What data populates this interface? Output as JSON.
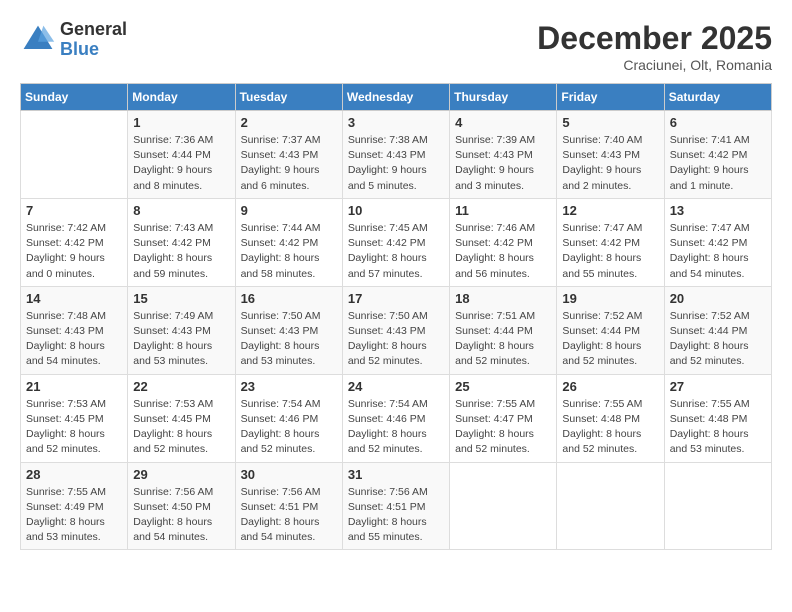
{
  "logo": {
    "general": "General",
    "blue": "Blue"
  },
  "header": {
    "month": "December 2025",
    "location": "Craciunei, Olt, Romania"
  },
  "weekdays": [
    "Sunday",
    "Monday",
    "Tuesday",
    "Wednesday",
    "Thursday",
    "Friday",
    "Saturday"
  ],
  "weeks": [
    [
      {
        "day": "",
        "sunrise": "",
        "sunset": "",
        "daylight": ""
      },
      {
        "day": "1",
        "sunrise": "Sunrise: 7:36 AM",
        "sunset": "Sunset: 4:44 PM",
        "daylight": "Daylight: 9 hours and 8 minutes."
      },
      {
        "day": "2",
        "sunrise": "Sunrise: 7:37 AM",
        "sunset": "Sunset: 4:43 PM",
        "daylight": "Daylight: 9 hours and 6 minutes."
      },
      {
        "day": "3",
        "sunrise": "Sunrise: 7:38 AM",
        "sunset": "Sunset: 4:43 PM",
        "daylight": "Daylight: 9 hours and 5 minutes."
      },
      {
        "day": "4",
        "sunrise": "Sunrise: 7:39 AM",
        "sunset": "Sunset: 4:43 PM",
        "daylight": "Daylight: 9 hours and 3 minutes."
      },
      {
        "day": "5",
        "sunrise": "Sunrise: 7:40 AM",
        "sunset": "Sunset: 4:43 PM",
        "daylight": "Daylight: 9 hours and 2 minutes."
      },
      {
        "day": "6",
        "sunrise": "Sunrise: 7:41 AM",
        "sunset": "Sunset: 4:42 PM",
        "daylight": "Daylight: 9 hours and 1 minute."
      }
    ],
    [
      {
        "day": "7",
        "sunrise": "Sunrise: 7:42 AM",
        "sunset": "Sunset: 4:42 PM",
        "daylight": "Daylight: 9 hours and 0 minutes."
      },
      {
        "day": "8",
        "sunrise": "Sunrise: 7:43 AM",
        "sunset": "Sunset: 4:42 PM",
        "daylight": "Daylight: 8 hours and 59 minutes."
      },
      {
        "day": "9",
        "sunrise": "Sunrise: 7:44 AM",
        "sunset": "Sunset: 4:42 PM",
        "daylight": "Daylight: 8 hours and 58 minutes."
      },
      {
        "day": "10",
        "sunrise": "Sunrise: 7:45 AM",
        "sunset": "Sunset: 4:42 PM",
        "daylight": "Daylight: 8 hours and 57 minutes."
      },
      {
        "day": "11",
        "sunrise": "Sunrise: 7:46 AM",
        "sunset": "Sunset: 4:42 PM",
        "daylight": "Daylight: 8 hours and 56 minutes."
      },
      {
        "day": "12",
        "sunrise": "Sunrise: 7:47 AM",
        "sunset": "Sunset: 4:42 PM",
        "daylight": "Daylight: 8 hours and 55 minutes."
      },
      {
        "day": "13",
        "sunrise": "Sunrise: 7:47 AM",
        "sunset": "Sunset: 4:42 PM",
        "daylight": "Daylight: 8 hours and 54 minutes."
      }
    ],
    [
      {
        "day": "14",
        "sunrise": "Sunrise: 7:48 AM",
        "sunset": "Sunset: 4:43 PM",
        "daylight": "Daylight: 8 hours and 54 minutes."
      },
      {
        "day": "15",
        "sunrise": "Sunrise: 7:49 AM",
        "sunset": "Sunset: 4:43 PM",
        "daylight": "Daylight: 8 hours and 53 minutes."
      },
      {
        "day": "16",
        "sunrise": "Sunrise: 7:50 AM",
        "sunset": "Sunset: 4:43 PM",
        "daylight": "Daylight: 8 hours and 53 minutes."
      },
      {
        "day": "17",
        "sunrise": "Sunrise: 7:50 AM",
        "sunset": "Sunset: 4:43 PM",
        "daylight": "Daylight: 8 hours and 52 minutes."
      },
      {
        "day": "18",
        "sunrise": "Sunrise: 7:51 AM",
        "sunset": "Sunset: 4:44 PM",
        "daylight": "Daylight: 8 hours and 52 minutes."
      },
      {
        "day": "19",
        "sunrise": "Sunrise: 7:52 AM",
        "sunset": "Sunset: 4:44 PM",
        "daylight": "Daylight: 8 hours and 52 minutes."
      },
      {
        "day": "20",
        "sunrise": "Sunrise: 7:52 AM",
        "sunset": "Sunset: 4:44 PM",
        "daylight": "Daylight: 8 hours and 52 minutes."
      }
    ],
    [
      {
        "day": "21",
        "sunrise": "Sunrise: 7:53 AM",
        "sunset": "Sunset: 4:45 PM",
        "daylight": "Daylight: 8 hours and 52 minutes."
      },
      {
        "day": "22",
        "sunrise": "Sunrise: 7:53 AM",
        "sunset": "Sunset: 4:45 PM",
        "daylight": "Daylight: 8 hours and 52 minutes."
      },
      {
        "day": "23",
        "sunrise": "Sunrise: 7:54 AM",
        "sunset": "Sunset: 4:46 PM",
        "daylight": "Daylight: 8 hours and 52 minutes."
      },
      {
        "day": "24",
        "sunrise": "Sunrise: 7:54 AM",
        "sunset": "Sunset: 4:46 PM",
        "daylight": "Daylight: 8 hours and 52 minutes."
      },
      {
        "day": "25",
        "sunrise": "Sunrise: 7:55 AM",
        "sunset": "Sunset: 4:47 PM",
        "daylight": "Daylight: 8 hours and 52 minutes."
      },
      {
        "day": "26",
        "sunrise": "Sunrise: 7:55 AM",
        "sunset": "Sunset: 4:48 PM",
        "daylight": "Daylight: 8 hours and 52 minutes."
      },
      {
        "day": "27",
        "sunrise": "Sunrise: 7:55 AM",
        "sunset": "Sunset: 4:48 PM",
        "daylight": "Daylight: 8 hours and 53 minutes."
      }
    ],
    [
      {
        "day": "28",
        "sunrise": "Sunrise: 7:55 AM",
        "sunset": "Sunset: 4:49 PM",
        "daylight": "Daylight: 8 hours and 53 minutes."
      },
      {
        "day": "29",
        "sunrise": "Sunrise: 7:56 AM",
        "sunset": "Sunset: 4:50 PM",
        "daylight": "Daylight: 8 hours and 54 minutes."
      },
      {
        "day": "30",
        "sunrise": "Sunrise: 7:56 AM",
        "sunset": "Sunset: 4:51 PM",
        "daylight": "Daylight: 8 hours and 54 minutes."
      },
      {
        "day": "31",
        "sunrise": "Sunrise: 7:56 AM",
        "sunset": "Sunset: 4:51 PM",
        "daylight": "Daylight: 8 hours and 55 minutes."
      },
      {
        "day": "",
        "sunrise": "",
        "sunset": "",
        "daylight": ""
      },
      {
        "day": "",
        "sunrise": "",
        "sunset": "",
        "daylight": ""
      },
      {
        "day": "",
        "sunrise": "",
        "sunset": "",
        "daylight": ""
      }
    ]
  ]
}
